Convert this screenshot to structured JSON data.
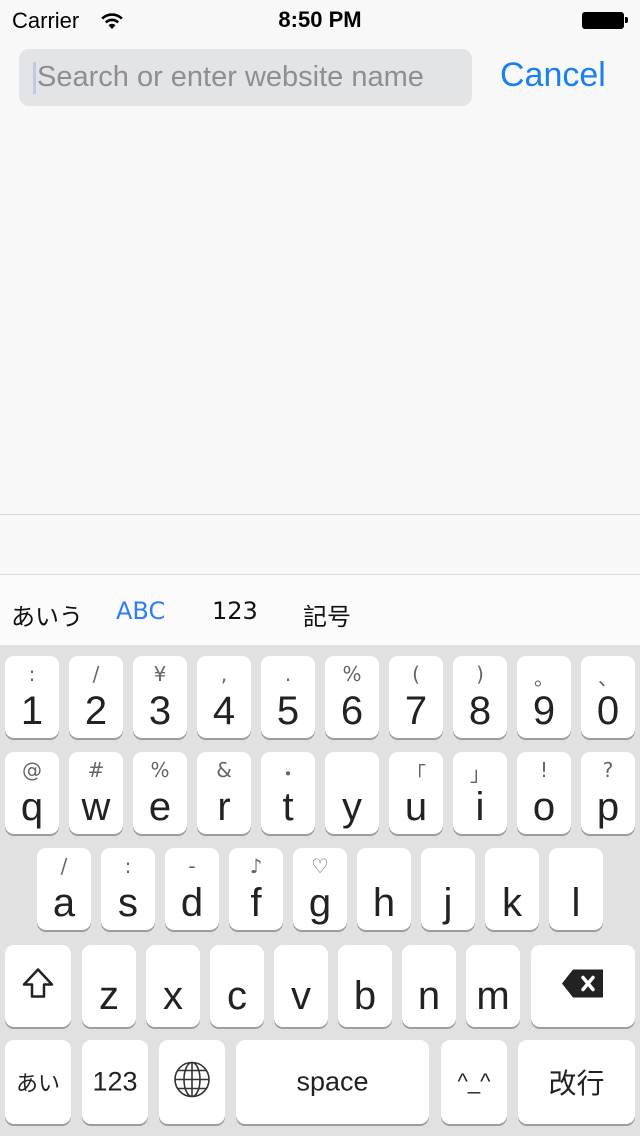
{
  "status_bar": {
    "carrier": "Carrier",
    "time": "8:50 PM",
    "wifi_icon": "wifi-icon",
    "battery_icon": "battery-icon"
  },
  "search": {
    "placeholder": "Search or enter website name",
    "value": "",
    "cancel_label": "Cancel"
  },
  "keyboard": {
    "modes": [
      {
        "label": "あいう",
        "active": false
      },
      {
        "label": "ABC",
        "active": true
      },
      {
        "label": "123",
        "active": false
      },
      {
        "label": "記号",
        "active": false
      }
    ],
    "rows": [
      [
        {
          "main": "1",
          "sub": ":"
        },
        {
          "main": "2",
          "sub": "/"
        },
        {
          "main": "3",
          "sub": "¥"
        },
        {
          "main": "4",
          "sub": ","
        },
        {
          "main": "5",
          "sub": "."
        },
        {
          "main": "6",
          "sub": "%"
        },
        {
          "main": "7",
          "sub": "("
        },
        {
          "main": "8",
          "sub": ")"
        },
        {
          "main": "9",
          "sub": "。"
        },
        {
          "main": "0",
          "sub": "、"
        }
      ],
      [
        {
          "main": "q",
          "sub": "@"
        },
        {
          "main": "w",
          "sub": "#"
        },
        {
          "main": "e",
          "sub": "%"
        },
        {
          "main": "r",
          "sub": "&"
        },
        {
          "main": "t",
          "sub": "・"
        },
        {
          "main": "y",
          "sub": ""
        },
        {
          "main": "u",
          "sub": "「"
        },
        {
          "main": "i",
          "sub": "」"
        },
        {
          "main": "o",
          "sub": "!"
        },
        {
          "main": "p",
          "sub": "?"
        }
      ],
      [
        {
          "main": "a",
          "sub": "/"
        },
        {
          "main": "s",
          "sub": ":"
        },
        {
          "main": "d",
          "sub": "-"
        },
        {
          "main": "f",
          "sub": "♪"
        },
        {
          "main": "g",
          "sub": "♡"
        },
        {
          "main": "h",
          "sub": ""
        },
        {
          "main": "j",
          "sub": ""
        },
        {
          "main": "k",
          "sub": ""
        },
        {
          "main": "l",
          "sub": ""
        }
      ],
      [
        {
          "main": "z"
        },
        {
          "main": "x"
        },
        {
          "main": "c"
        },
        {
          "main": "v"
        },
        {
          "main": "b"
        },
        {
          "main": "n"
        },
        {
          "main": "m"
        }
      ]
    ],
    "shift_icon": "shift-icon",
    "delete_icon": "delete-icon",
    "bottom": {
      "kana_label": "あい",
      "numbers_label": "123",
      "globe_icon": "globe-icon",
      "space_label": "space",
      "emoticon_label": "^_^",
      "return_label": "改行"
    }
  }
}
